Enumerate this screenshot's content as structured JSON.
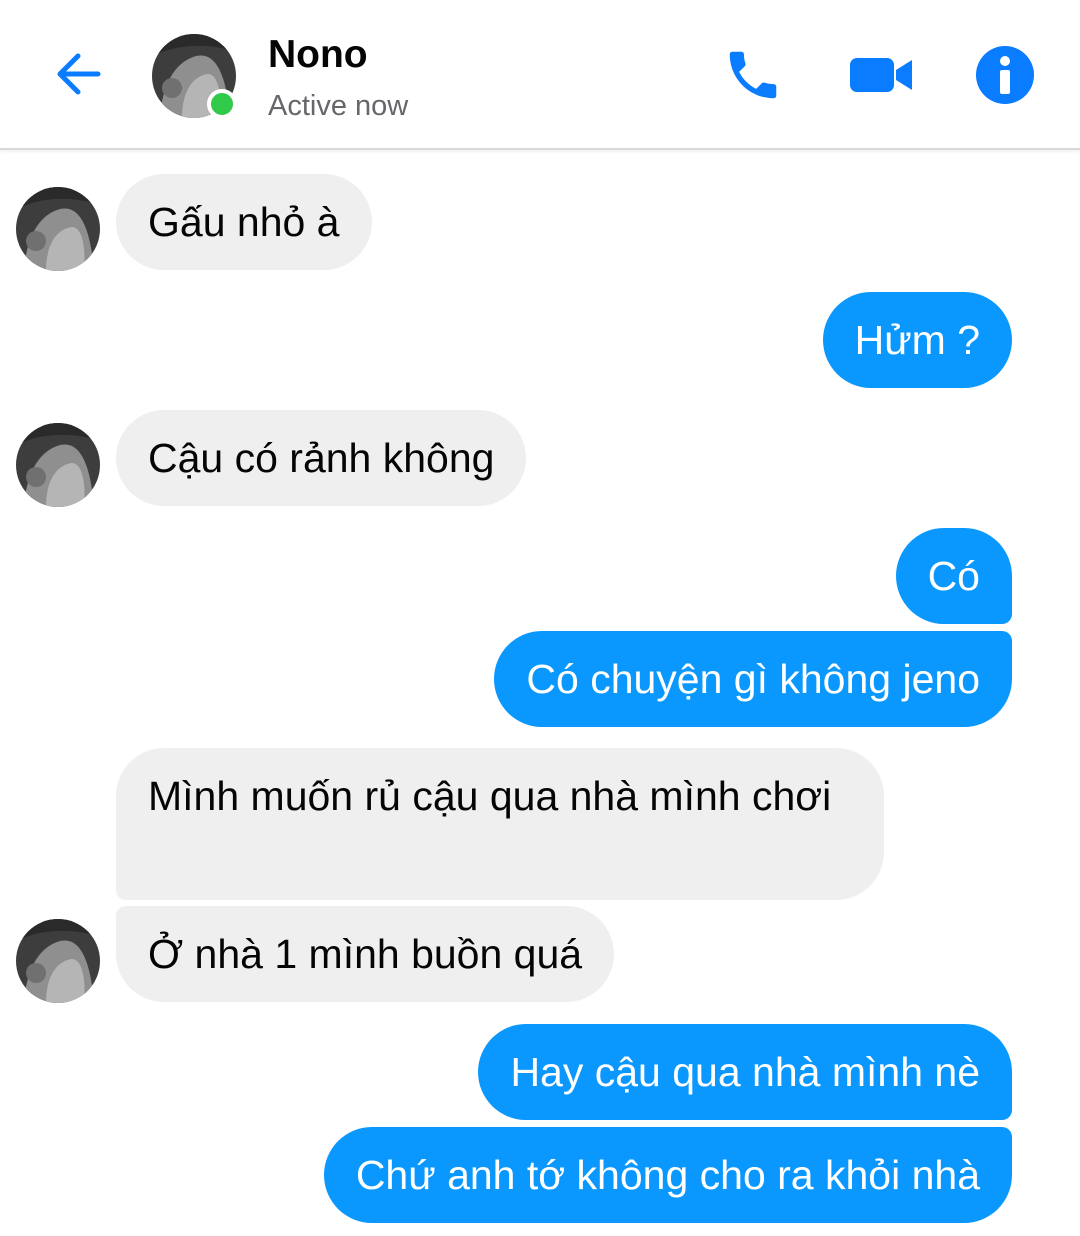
{
  "header": {
    "contact_name": "Nono",
    "status": "Active now",
    "icons": [
      "back-arrow-icon",
      "phone-icon",
      "video-camera-icon",
      "info-icon"
    ],
    "presence": "online"
  },
  "messages": [
    {
      "from": "contact",
      "text": "Gấu nhỏ à"
    },
    {
      "from": "me",
      "text": "Hửm ?"
    },
    {
      "from": "contact",
      "text": "Cậu có rảnh không"
    },
    {
      "from": "me",
      "text": "Có"
    },
    {
      "from": "me",
      "text": "Có chuyện  gì không jeno"
    },
    {
      "from": "contact",
      "text": "Mình muốn rủ cậu qua nhà mình chơi"
    },
    {
      "from": "contact",
      "text": "Ở nhà 1 mình buồn quá"
    },
    {
      "from": "me",
      "text": "Hay cậu qua nhà mình nè"
    },
    {
      "from": "me",
      "text": "Chứ anh tớ không cho ra khỏi nhà"
    }
  ],
  "colors": {
    "accent": "#0a98ff",
    "incoming_bubble": "#efefef",
    "online": "#31c94a",
    "icon_blue": "#0a7cff"
  }
}
